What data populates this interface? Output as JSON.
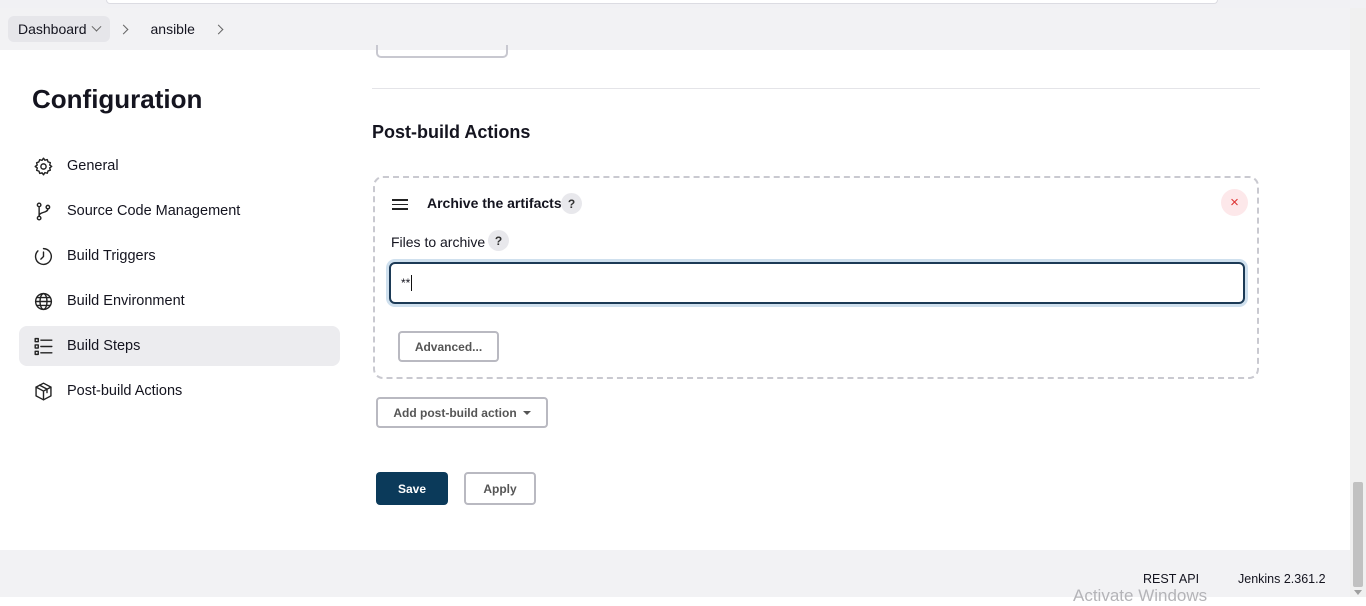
{
  "breadcrumb": {
    "items": [
      {
        "label": "Dashboard"
      },
      {
        "label": "ansible"
      }
    ]
  },
  "sidebar": {
    "title": "Configuration",
    "items": [
      {
        "label": "General",
        "icon": "gear-icon"
      },
      {
        "label": "Source Code Management",
        "icon": "branch-icon"
      },
      {
        "label": "Build Triggers",
        "icon": "clock-icon"
      },
      {
        "label": "Build Environment",
        "icon": "globe-icon"
      },
      {
        "label": "Build Steps",
        "icon": "list-icon",
        "active": true
      },
      {
        "label": "Post-build Actions",
        "icon": "package-icon"
      }
    ]
  },
  "main": {
    "section_title": "Post-build Actions",
    "action": {
      "title": "Archive the artifacts",
      "help": "?",
      "close": "×",
      "field_label": "Files to archive",
      "field_help": "?",
      "field_value": "**",
      "advanced_label": "Advanced..."
    },
    "add_action_label": "Add post-build action",
    "save_label": "Save",
    "apply_label": "Apply"
  },
  "footer": {
    "rest_api": "REST API",
    "version": "Jenkins 2.361.2",
    "watermark": "Activate Windows"
  },
  "colors": {
    "primary": "#0b3a5a",
    "focus_ring": "#cfe0ee",
    "danger": "#dd3333"
  }
}
